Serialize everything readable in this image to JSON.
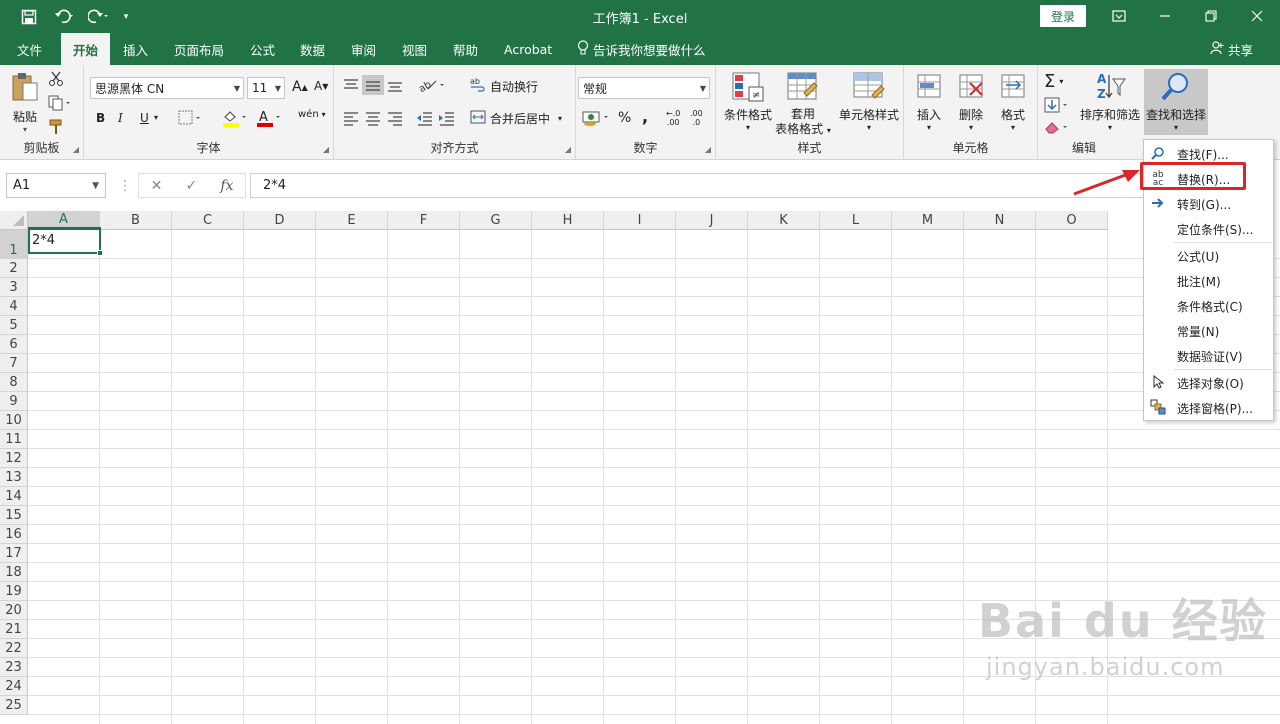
{
  "window": {
    "title": "工作簿1  -  Excel",
    "login_label": "登录",
    "accent": "#217346"
  },
  "quick_access": {
    "save_icon": "save-icon",
    "undo_icon": "undo-icon",
    "redo_icon": "redo-icon",
    "customize_icon": "chevron-down-icon"
  },
  "tabs": [
    {
      "label": "文件"
    },
    {
      "label": "开始"
    },
    {
      "label": "插入"
    },
    {
      "label": "页面布局"
    },
    {
      "label": "公式"
    },
    {
      "label": "数据"
    },
    {
      "label": "审阅"
    },
    {
      "label": "视图"
    },
    {
      "label": "帮助"
    },
    {
      "label": "Acrobat"
    }
  ],
  "tellme": "告诉我你想要做什么",
  "share": "共享",
  "ribbon": {
    "clipboard": {
      "label": "剪贴板",
      "paste": "粘贴"
    },
    "font": {
      "label": "字体",
      "font_name": "思源黑体 CN",
      "font_size": "11",
      "bold": "B",
      "italic": "I",
      "underline": "U",
      "grow": "A",
      "shrink": "A",
      "phonetic": "wén"
    },
    "alignment": {
      "label": "对齐方式",
      "wrap": "自动换行",
      "merge": "合并后居中"
    },
    "number": {
      "label": "数字",
      "format": "常规",
      "percent": "%",
      "comma": ",",
      "inc_decimal": ".00",
      "dec_decimal": ".0"
    },
    "styles": {
      "label": "样式",
      "conditional": "条件格式",
      "table_line1": "套用",
      "table_line2": "表格格式",
      "cell_styles": "单元格样式"
    },
    "cells": {
      "label": "单元格",
      "insert": "插入",
      "delete": "删除",
      "format": "格式"
    },
    "editing": {
      "label": "编辑",
      "sort": "排序和筛选",
      "find": "查找和选择"
    }
  },
  "formula_bar": {
    "name_box": "A1",
    "cancel": "✕",
    "enter": "✓",
    "fx": "fx",
    "formula": "2*4"
  },
  "sheet": {
    "columns": [
      "A",
      "B",
      "C",
      "D",
      "E",
      "F",
      "G",
      "H",
      "I",
      "J",
      "K",
      "L",
      "M",
      "N",
      "O"
    ],
    "rows": [
      "1",
      "2",
      "3",
      "4",
      "5",
      "6",
      "7",
      "8",
      "9",
      "10",
      "11",
      "12",
      "13",
      "14",
      "15",
      "16",
      "17",
      "18",
      "19",
      "20",
      "21",
      "22",
      "23",
      "24",
      "25"
    ],
    "cell_a1": "2*4"
  },
  "dropdown": {
    "items": [
      {
        "label": "查找(F)...",
        "icon": "search-icon"
      },
      {
        "label": "替换(R)...",
        "icon": "replace-icon"
      },
      {
        "label": "转到(G)...",
        "icon": "arrow-right-icon"
      },
      {
        "label": "定位条件(S)...",
        "icon": ""
      },
      {
        "label": "公式(U)",
        "icon": ""
      },
      {
        "label": "批注(M)",
        "icon": ""
      },
      {
        "label": "条件格式(C)",
        "icon": ""
      },
      {
        "label": "常量(N)",
        "icon": ""
      },
      {
        "label": "数据验证(V)",
        "icon": ""
      },
      {
        "label": "选择对象(O)",
        "icon": "cursor-icon"
      },
      {
        "label": "选择窗格(P)...",
        "icon": "selection-pane-icon"
      }
    ],
    "highlight_color": "#d9262b"
  },
  "watermark": {
    "logo": "Bai du 经验",
    "url": "jingyan.baidu.com"
  }
}
